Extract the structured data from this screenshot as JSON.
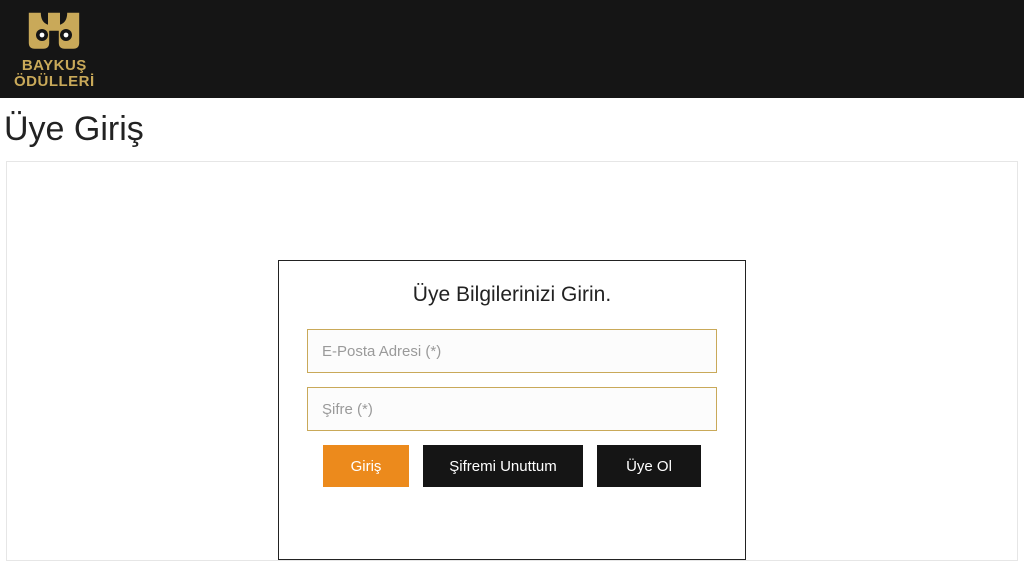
{
  "brand": {
    "line1": "BAYKUŞ",
    "line2": "ÖDÜLLERİ"
  },
  "page": {
    "title": "Üye Giriş"
  },
  "login": {
    "heading": "Üye Bilgilerinizi Girin.",
    "email_placeholder": "E-Posta Adresi (*)",
    "password_placeholder": "Şifre (*)",
    "submit_label": "Giriş",
    "forgot_label": "Şifremi Unuttum",
    "signup_label": "Üye Ol"
  }
}
